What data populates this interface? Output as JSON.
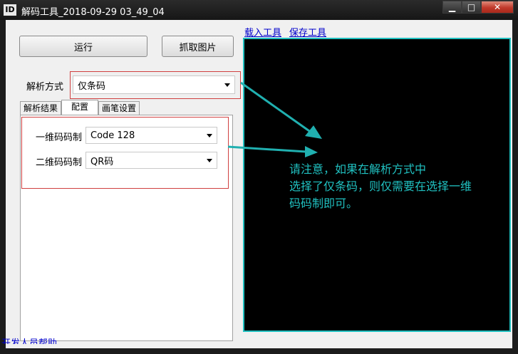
{
  "window": {
    "app_icon_text": "ID",
    "title": "解码工具_2018-09-29 03_49_04",
    "controls": {
      "minimize": "▁",
      "maximize": "□",
      "close": "✕"
    }
  },
  "toolbar": {
    "run_label": "运行",
    "capture_label": "抓取图片",
    "load_tool_link": "载入工具",
    "save_tool_link": "保存工具"
  },
  "parse_mode": {
    "label": "解析方式",
    "value": "仅条码"
  },
  "tabs": [
    {
      "label": "解析结果"
    },
    {
      "label": "配置"
    },
    {
      "label": "画笔设置"
    }
  ],
  "config": {
    "barcode_1d_label": "一维码码制",
    "barcode_1d_value": "Code 128",
    "barcode_2d_label": "二维码码制",
    "barcode_2d_value": "QR码"
  },
  "note_lines": [
    "请注意，如果在解析方式中",
    "选择了仅条码，则仅需要在选择一维",
    "码码制即可。"
  ],
  "footer_link": "开发人员帮助",
  "colors": {
    "annotation": "#20c0c0",
    "highlight_box": "#d04040",
    "link": "#0000cc"
  }
}
